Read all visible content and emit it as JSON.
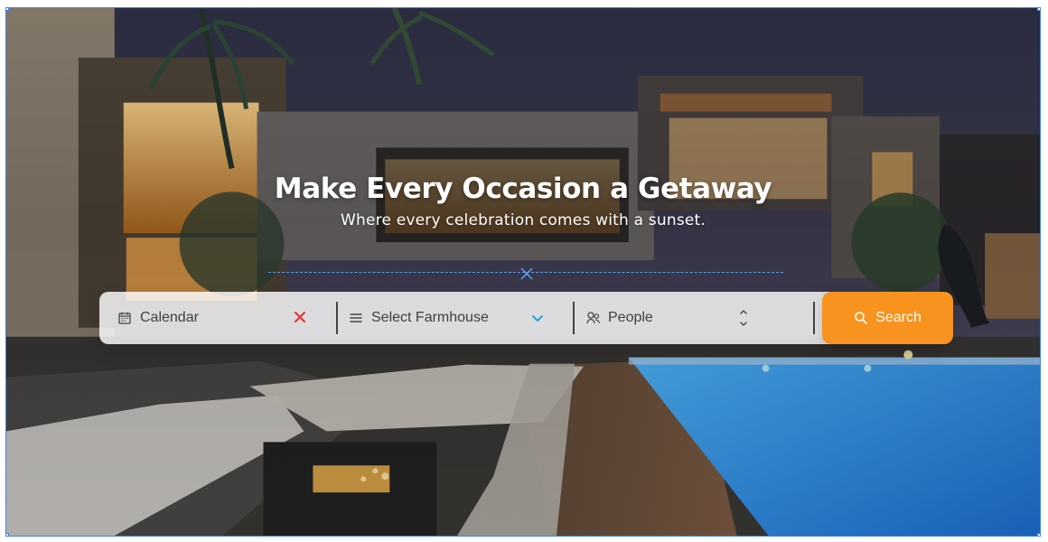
{
  "hero": {
    "title": "Make Every Occasion a Getaway",
    "subtitle": "Where every celebration comes with a sunset."
  },
  "search": {
    "calendar_label": "Calendar",
    "farmhouse_label": "Select Farmhouse",
    "people_label": "People",
    "button_label": "Search"
  },
  "colors": {
    "accent": "#f7931e",
    "clear": "#ef2d2d",
    "dropdown": "#2f9fd4",
    "guide": "#60a5fa",
    "bar_background": "#ffffff"
  },
  "icons": {
    "calendar": "calendar-icon",
    "clear": "close-icon",
    "farmhouse": "menu-icon",
    "dropdown": "chevron-down-icon",
    "people": "users-icon",
    "stepper": "stepper-icon",
    "search": "search-icon"
  }
}
